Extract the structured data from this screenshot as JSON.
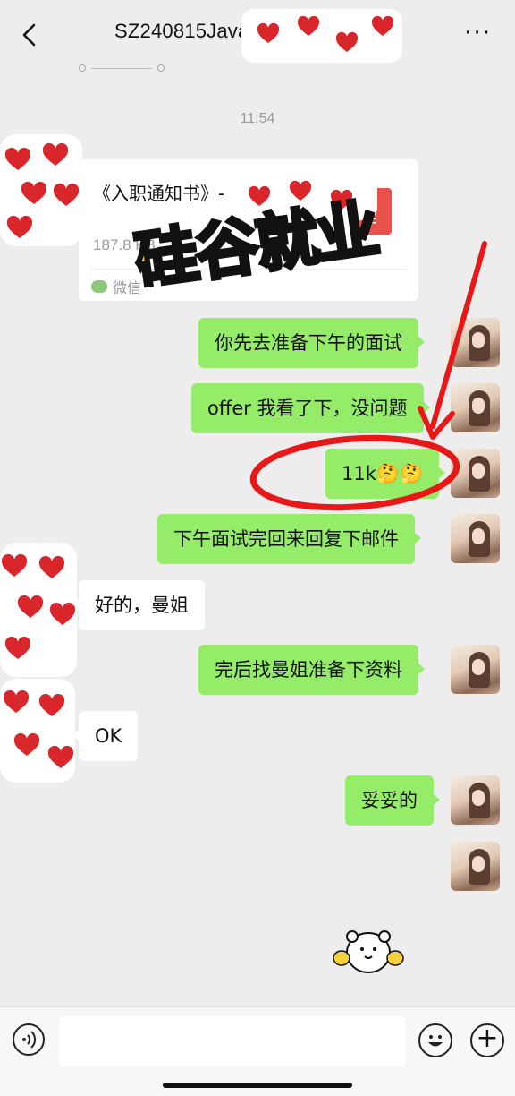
{
  "header": {
    "title": "SZ240815Java",
    "more": "···"
  },
  "time": "11:54",
  "file": {
    "name": "《入职通知书》-",
    "size": "187.8 KB",
    "source": "微信",
    "icon_text": "F"
  },
  "messages": [
    {
      "dir": "out",
      "text": "你先去准备下午的面试"
    },
    {
      "dir": "out",
      "text": "offer 我看了下，没问题"
    },
    {
      "dir": "out",
      "text": "11k🤔🤔"
    },
    {
      "dir": "out",
      "text": "下午面试完回来回复下邮件"
    },
    {
      "dir": "in",
      "text": "好的，曼姐"
    },
    {
      "dir": "out",
      "text": "完后找曼姐准备下资料"
    },
    {
      "dir": "in",
      "text": "OK"
    },
    {
      "dir": "out",
      "text": "妥妥的"
    }
  ],
  "overlay": {
    "stamp": "硅谷就业"
  },
  "colors": {
    "outgoing_bubble": "#95ec69",
    "incoming_bubble": "#ffffff",
    "annotation": "#e81818",
    "background": "#ededed"
  },
  "icons": {
    "back": "chevron-left-icon",
    "more": "more-icon",
    "voice": "voice-icon",
    "emoji": "emoji-icon",
    "plus": "plus-icon"
  }
}
